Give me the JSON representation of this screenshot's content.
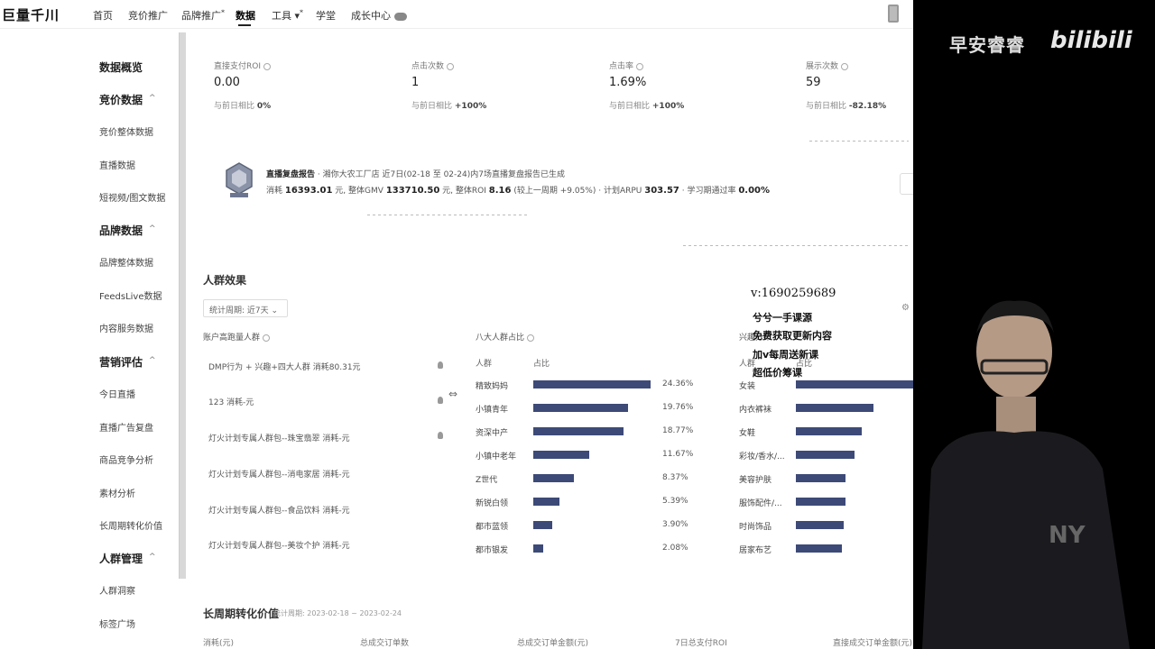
{
  "app": {
    "logo": "巨量千川"
  },
  "nav": {
    "items": [
      "首页",
      "竞价推广",
      "品牌推广",
      "数据",
      "工具",
      "学堂",
      "成长中心"
    ],
    "brand_sup": "*",
    "tool_sup": "*"
  },
  "sidebar": {
    "groups": [
      {
        "title": "数据概览"
      },
      {
        "title": "竞价数据",
        "chevron": "^",
        "items": [
          "竞价整体数据",
          "直播数据",
          "短视频/图文数据"
        ]
      },
      {
        "title": "品牌数据",
        "chevron": "^",
        "items": [
          "品牌整体数据",
          "FeedsLive数据",
          "内容服务数据"
        ]
      },
      {
        "title": "营销评估",
        "chevron": "^",
        "items": [
          "今日直播",
          "直播广告复盘",
          "商品竞争分析",
          "素材分析",
          "长周期转化价值"
        ]
      },
      {
        "title": "人群管理",
        "chevron": "^",
        "items": [
          "人群洞察",
          "标签广场"
        ]
      }
    ]
  },
  "metrics": [
    {
      "label": "直接支付ROI",
      "value": "0.00",
      "sub_label": "与前日相比",
      "sub_value": "0%"
    },
    {
      "label": "点击次数",
      "value": "1",
      "sub_label": "与前日相比",
      "sub_value": "+100%"
    },
    {
      "label": "点击率",
      "value": "1.69%",
      "sub_label": "与前日相比",
      "sub_value": "+100%"
    },
    {
      "label": "展示次数",
      "value": "59",
      "sub_label": "与前日相比",
      "sub_value": "-82.18%"
    }
  ],
  "report": {
    "title": "直播复盘报告",
    "desc": "· 湘你大农工厂店  近7日(02-18 至 02-24)内7场直播复盘报告已生成",
    "spend_label": "消耗",
    "spend": "16393.01",
    "spend_unit": "元",
    "gmv_label": "整体GMV",
    "gmv": "133710.50",
    "gmv_unit": "元",
    "roi_label": "整体ROI",
    "roi": "8.16",
    "roi_cmp": "(较上一周期 +9.05%)",
    "arpu_label": "· 计划ARPU",
    "arpu": "303.57",
    "learn_label": "· 学习期通过率",
    "learn": "0.00%"
  },
  "audience": {
    "title": "人群效果",
    "period": "统计周期: 近7天",
    "col1_title": "账户高跑量人群",
    "col2_title": "八大人群占比",
    "col3_title": "兴趣分布",
    "segments": [
      "DMP行为 + 兴趣+四大人群  消耗80.31元",
      "123  消耗-元",
      "灯火计划专属人群包--珠宝翡翠  消耗-元",
      "灯火计划专属人群包--消电家居  消耗-元",
      "灯火计划专属人群包--食品饮料  消耗-元",
      "灯火计划专属人群包--美妆个护  消耗-元"
    ],
    "table_head": {
      "crowd": "人群",
      "ratio": "占比"
    },
    "crowds": [
      {
        "name": "精致妈妈",
        "pct": "24.36%",
        "value": 24.36
      },
      {
        "name": "小镇青年",
        "pct": "19.76%",
        "value": 19.76
      },
      {
        "name": "资深中产",
        "pct": "18.77%",
        "value": 18.77
      },
      {
        "name": "小镇中老年",
        "pct": "11.67%",
        "value": 11.67
      },
      {
        "name": "Z世代",
        "pct": "8.37%",
        "value": 8.37
      },
      {
        "name": "新锐白领",
        "pct": "5.39%",
        "value": 5.39
      },
      {
        "name": "都市蓝领",
        "pct": "3.90%",
        "value": 3.9
      },
      {
        "name": "都市银发",
        "pct": "2.08%",
        "value": 2.08
      }
    ],
    "interest_head": {
      "crowd": "人群",
      "ratio": "占比"
    },
    "interests": [
      {
        "name": "女装",
        "value": 100
      },
      {
        "name": "内衣裤袜",
        "value": 66
      },
      {
        "name": "女鞋",
        "value": 56
      },
      {
        "name": "彩妆/香水/...",
        "value": 50
      },
      {
        "name": "美容护肤",
        "value": 42
      },
      {
        "name": "服饰配件/...",
        "value": 42
      },
      {
        "name": "时尚饰品",
        "value": 41
      },
      {
        "name": "居家布艺",
        "value": 39
      }
    ]
  },
  "ltv": {
    "title": "长周期转化价值",
    "range": "统计周期: 2023-02-18 ~ 2023-02-24",
    "cols": [
      "消耗(元)",
      "总成交订单数",
      "总成交订单金额(元)",
      "7日总支付ROI",
      "直接成交订单金额(元)"
    ]
  },
  "overlay": {
    "watermark": "早安睿睿",
    "platform": "bilibili",
    "contact": "v:1690259689",
    "lines": [
      "兮兮一手课源",
      "免费获取更新内容",
      "加v每周送新课",
      "超低价筹课"
    ]
  },
  "colors": {
    "bar": "#3d4a78",
    "accent": "#2d3a66"
  }
}
